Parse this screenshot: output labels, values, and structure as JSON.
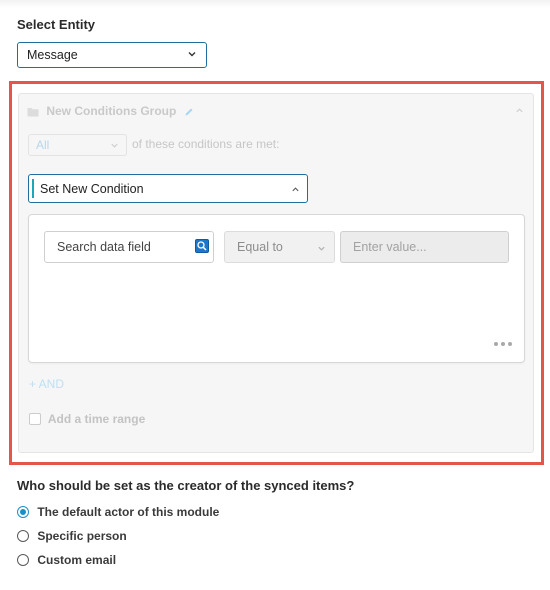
{
  "entity": {
    "label": "Select Entity",
    "selected": "Message"
  },
  "group": {
    "title": "New Conditions Group",
    "match_mode": "All",
    "match_text": "of these conditions are met:",
    "condition_select": "Set New Condition",
    "condition": {
      "field_placeholder": "Search data field",
      "operator": "Equal to",
      "value_placeholder": "Enter value..."
    },
    "add_and": "+ AND",
    "time_range": "Add a time range"
  },
  "creator": {
    "question": "Who should be set as the creator of the synced items?",
    "options": [
      {
        "label": "The default actor of this module",
        "checked": true
      },
      {
        "label": "Specific person",
        "checked": false
      },
      {
        "label": "Custom email",
        "checked": false
      }
    ]
  },
  "colors": {
    "accent": "#1a8fc7",
    "highlight_frame": "#e4564a"
  },
  "icons": [
    "chevron-down-icon",
    "folder-icon",
    "pencil-icon",
    "chevron-up-icon",
    "search-icon",
    "more-icon"
  ]
}
